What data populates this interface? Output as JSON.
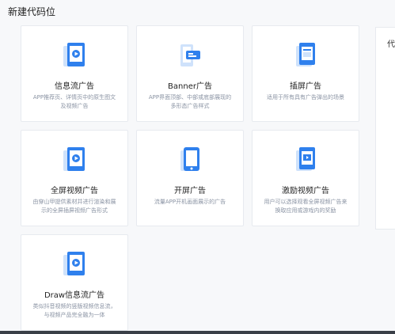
{
  "page": {
    "title": "新建代码位"
  },
  "side_panel": {
    "label": "代"
  },
  "cards": [
    {
      "title": "信息流广告",
      "desc": "APP推荐页、详情页中的原生图文及视频广告"
    },
    {
      "title": "Banner广告",
      "desc": "APP界面顶部、中部或底部展现的多形态广告样式"
    },
    {
      "title": "插屏广告",
      "desc": "适用于所有具有广告弹出的场景"
    },
    {
      "title": "全屏视频广告",
      "desc": "由穿山甲提供素材并进行渲染和展示的全屏插屏视频广告形式"
    },
    {
      "title": "开屏广告",
      "desc": "流量APP开机画面展示的广告"
    },
    {
      "title": "激励视频广告",
      "desc": "用户可以选择观看全屏视频广告来换取应用或游戏内的奖励"
    },
    {
      "title": "Draw信息流广告",
      "desc": "类似抖音视频的竖版视频信息流，与视频产品完全融为一体"
    }
  ],
  "colors": {
    "accent": "#2f80ed",
    "accent_light": "#cfe2fb"
  }
}
